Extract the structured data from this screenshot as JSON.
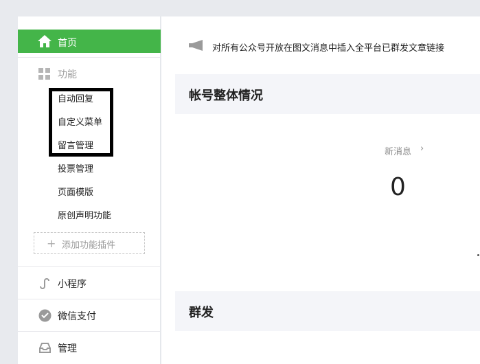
{
  "sidebar": {
    "home": {
      "label": "首页",
      "icon": "home-icon",
      "active_color": "#44b549"
    },
    "functions": {
      "label": "功能",
      "icon": "grid-icon",
      "items": [
        {
          "label": "自动回复"
        },
        {
          "label": "自定义菜单"
        },
        {
          "label": "留言管理"
        },
        {
          "label": "投票管理"
        },
        {
          "label": "页面模版"
        },
        {
          "label": "原创声明功能"
        }
      ],
      "add_plugin_label": "添加功能插件"
    },
    "mini_program": {
      "label": "小程序",
      "icon": "mini-program-icon"
    },
    "wechat_pay": {
      "label": "微信支付",
      "icon": "wechat-pay-icon"
    },
    "manage": {
      "label": "管理",
      "icon": "inbox-icon"
    }
  },
  "main": {
    "notice": {
      "icon": "megaphone-icon",
      "text": "对所有公众号开放在图文消息中插入全平台已群发文章链接"
    },
    "account_card": {
      "title": "帐号整体情况"
    },
    "stats": {
      "new_messages_label": "新消息",
      "new_messages_value": "0"
    },
    "broadcast_card": {
      "title": "群发"
    }
  }
}
